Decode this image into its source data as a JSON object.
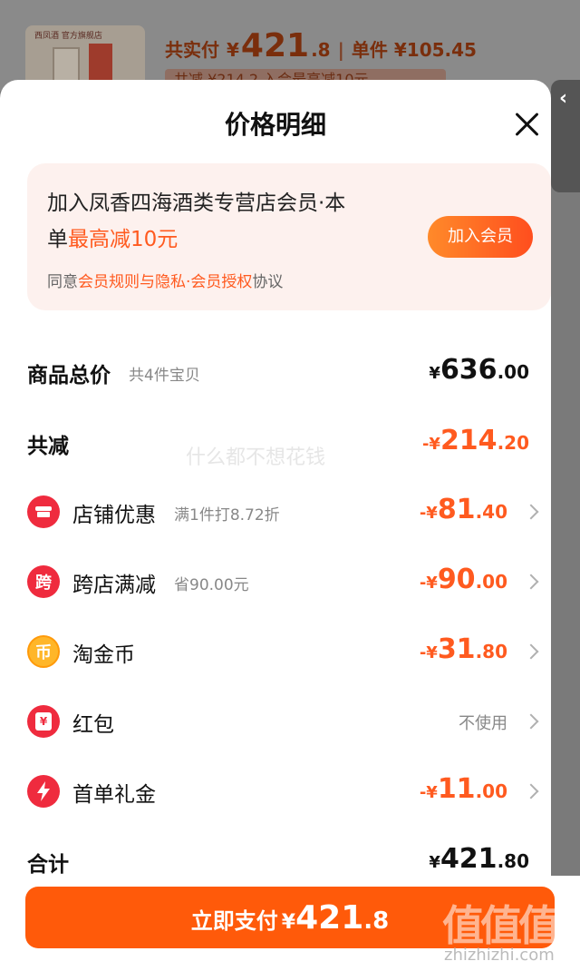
{
  "background": {
    "price_prefix": "共实付",
    "price_symbol": "¥",
    "price_int": "421",
    "price_dec": ".8",
    "unit_label": "单件 ¥105.45",
    "sub_text": "共减 ¥214.2  入会最高减10元",
    "thumb_label": "西凤酒 官方旗舰店"
  },
  "sheet": {
    "title": "价格明细"
  },
  "member": {
    "line1": "加入凤香四海酒类专营店会员·本",
    "line2_prefix": "单",
    "line2_highlight": "最高减10元",
    "join_label": "加入会员",
    "agree_prefix": "同意",
    "agree_link": "会员规则与隐私·会员授权",
    "agree_suffix": "协议"
  },
  "rows": {
    "total": {
      "name": "商品总价",
      "note": "共4件宝贝",
      "sym": "¥",
      "int": "636",
      "dec": ".00"
    },
    "discount": {
      "name": "共减",
      "sym": "-¥",
      "int": "214",
      "dec": ".20"
    },
    "shop": {
      "name": "店铺优惠",
      "note": "满1件打8.72折",
      "sym": "-¥",
      "int": "81",
      "dec": ".40",
      "icon": "shop-icon"
    },
    "cross": {
      "name": "跨店满减",
      "note": "省90.00元",
      "sym": "-¥",
      "int": "90",
      "dec": ".00",
      "icon_text": "跨"
    },
    "coin": {
      "name": "淘金币",
      "sym": "-¥",
      "int": "31",
      "dec": ".80",
      "icon_text": "币"
    },
    "redpacket": {
      "name": "红包",
      "value": "不使用",
      "icon_text": "¥"
    },
    "firstorder": {
      "name": "首单礼金",
      "sym": "-¥",
      "int": "11",
      "dec": ".00",
      "icon": "lightning-icon"
    },
    "sum": {
      "name": "合计",
      "sym": "¥",
      "int": "421",
      "dec": ".80"
    }
  },
  "pay": {
    "label": "立即支付",
    "sym": "¥",
    "int": "421",
    "dec": ".8"
  },
  "watermark": {
    "text": "什么都不想花钱",
    "logo": "值值值",
    "url": "zhizhizhi.com"
  },
  "colors": {
    "accent": "#ff5a1f",
    "pay_button": "#ff5a0a"
  }
}
